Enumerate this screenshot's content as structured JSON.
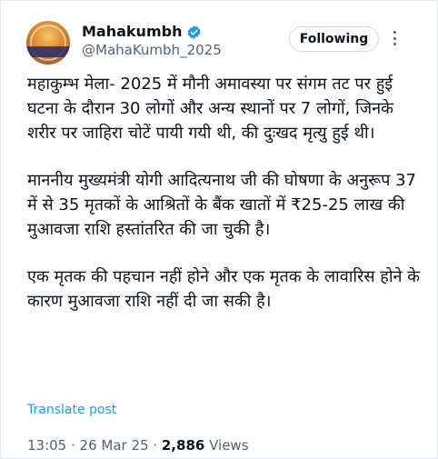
{
  "author": {
    "display_name": "Mahakumbh",
    "handle": "@MahaKumbh_2025",
    "verified_color": "#1d9bf0"
  },
  "follow_button": {
    "label": "Following"
  },
  "more_icon": "more-dots-vertical",
  "tweet": {
    "paragraphs": [
      "महाकुम्भ मेला- 2025 में मौनी अमावस्या पर संगम तट पर हुई घटना के दौरान 30 लोगों और अन्य स्थानों पर 7 लोगों, जिनके शरीर पर जाहिरा चोटें पायी गयी थी, की दुःखद मृत्यु हुई थी।",
      "माननीय मुख्यमंत्री योगी आदित्यनाथ जी की घोषणा के अनुरूप 37 में से 35 मृतकों के आश्रितों के बैंक खातों में ₹25-25 लाख की मुआवजा राशि हस्तांतरित की जा चुकी है।",
      "एक मृतक की पहचान नहीं होने और एक मृतक के लावारिस होने के कारण मुआवजा राशि नहीं दी जा सकी है।"
    ],
    "translate_label": "Translate post"
  },
  "meta": {
    "time": "13:05",
    "separator": " · ",
    "date": "26 Mar 25",
    "views_count": "2,886",
    "views_label": " Views"
  }
}
